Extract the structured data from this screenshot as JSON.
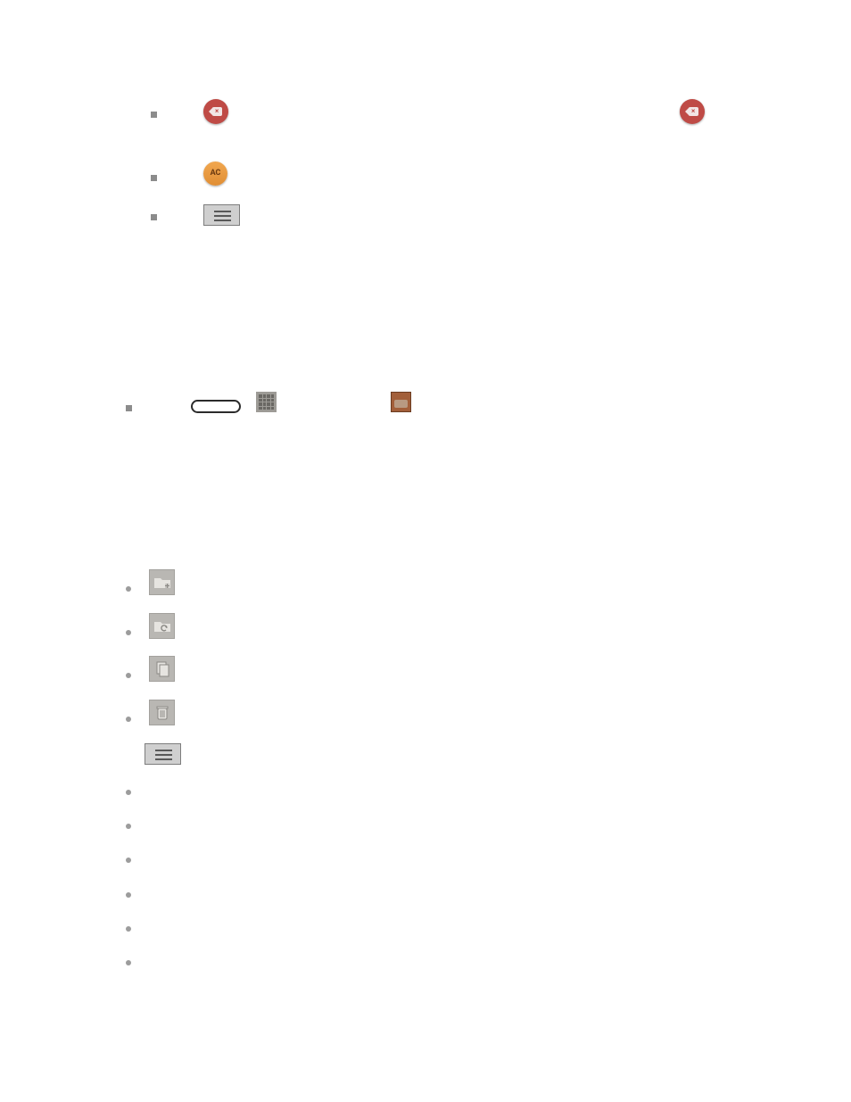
{
  "badges": {
    "red_left": {
      "name": "backspace-icon"
    },
    "red_right": {
      "name": "backspace-icon"
    },
    "orange": {
      "label": "AC"
    }
  },
  "hamburger_buttons": {
    "top": {
      "name": "hamburger-menu"
    },
    "bottom": {
      "name": "hamburger-menu"
    }
  },
  "mid_row": {
    "pill": {
      "name": "input-pill",
      "value": ""
    },
    "grid_icon": {
      "name": "grid-icon"
    },
    "box_icon": {
      "name": "picture-box-icon"
    }
  },
  "action_icons": [
    {
      "name": "folder-add-icon"
    },
    {
      "name": "folder-refresh-icon"
    },
    {
      "name": "copy-icon"
    },
    {
      "name": "trash-icon"
    }
  ],
  "list_bullets_top_count": 3,
  "list_bullets_mid_count": 1,
  "list_bullets_action_count": 4,
  "list_bullets_bottom_count": 6
}
